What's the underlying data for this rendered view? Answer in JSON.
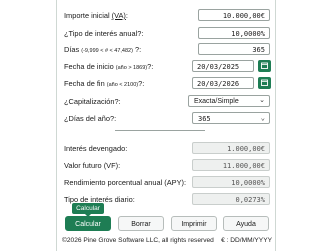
{
  "form": {
    "principal": {
      "label_pre": "Importe inicial ",
      "label_u": "(VA)",
      "label_post": ":",
      "value": "10.000,00€"
    },
    "rate": {
      "label": "¿Tipo de interés anual?:",
      "value": "10,0000%"
    },
    "days": {
      "label": "Días",
      "hint": "(-9,999 < # < 47,482)",
      "label_post": "?:",
      "value": "365"
    },
    "start": {
      "label": "Fecha de inicio",
      "hint": "(año > 1869)",
      "label_post": "?:",
      "value": "20/03/2025"
    },
    "end": {
      "label": "Fecha de fin",
      "hint": "(año < 2100)",
      "label_post": "?:",
      "value": "20/03/2026"
    },
    "compounding": {
      "label": "¿Capitalización?:",
      "value": "Exacta/Simple"
    },
    "days_year": {
      "label": "¿Días del año?:",
      "value": "365"
    }
  },
  "results": {
    "interest": {
      "label": "Interés devengado:",
      "value": "1.000,00€"
    },
    "future_value": {
      "label": "Valor futuro (VF):",
      "value": "11.000,00€"
    },
    "apy": {
      "label": "Rendimiento porcentual anual (APY):",
      "value": "10,0000%"
    },
    "daily_rate": {
      "label": "Tipo de interés diario:",
      "value": "0,0273%"
    }
  },
  "buttons": {
    "calculate": "Calcular",
    "clear": "Borrar",
    "print": "Imprimir",
    "help": "Ayuda"
  },
  "tooltip": "Calcular",
  "footer": {
    "copyright": "©2026 Pine Grove Software LLC, all rights reserved",
    "locale": "€ : DD/MM/YYYY"
  },
  "colors": {
    "accent": "#1e7d54"
  },
  "icons": {
    "calendar": "calendar-icon",
    "dropdown": "chevron-down-icon"
  }
}
